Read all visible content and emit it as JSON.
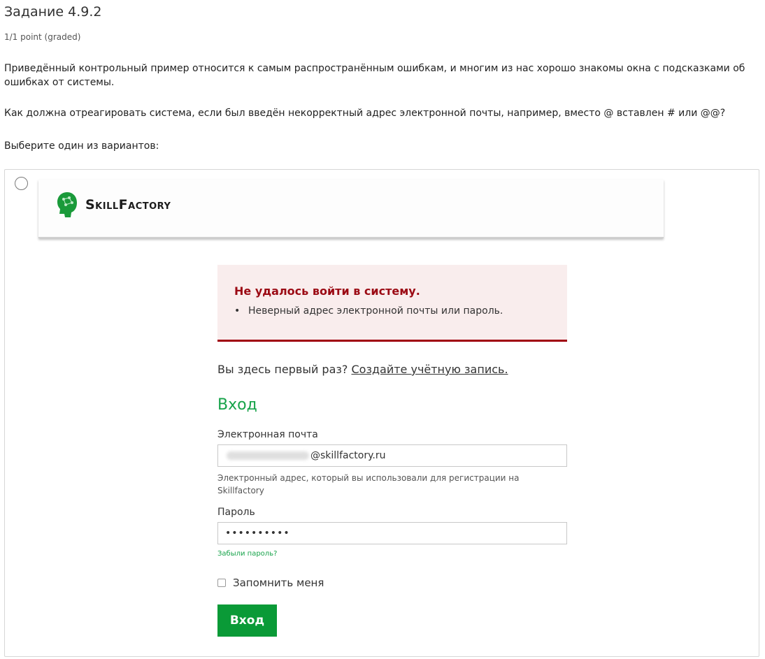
{
  "task": {
    "title": "Задание 4.9.2",
    "points": "1/1 point (graded)",
    "paragraph1": "Приведённый контрольный пример относится к самым распространённым ошибкам, и многим из нас хорошо знакомы окна с подсказками об ошибках от системы.",
    "paragraph2": "Как должна отреагировать система, если был введён некорректный адрес электронной почты, например, вместо @ вставлен # или @@?",
    "paragraph3": "Выберите один из вариантов:"
  },
  "option": {
    "logo_text": "SkillFactory",
    "error": {
      "title": "Не удалось войти в систему.",
      "bullet": "•",
      "item": "Неверный адрес электронной почты или пароль."
    },
    "first_time": {
      "text": "Вы здесь первый раз?",
      "link": "Создайте учётную запись."
    },
    "login_heading": "Вход",
    "email": {
      "label": "Электронная почта",
      "value_domain": "@skillfactory.ru",
      "hint": "Электронный адрес, который вы использовали для регистрации на Skillfactory"
    },
    "password": {
      "label": "Пароль",
      "value": "••••••••••",
      "forgot": "Забыли пароль?"
    },
    "remember_label": "Запомнить меня",
    "submit_label": "Вход"
  },
  "colors": {
    "brand_green": "#0a9a37",
    "heading_green": "#17a34a",
    "error_red": "#9b0a14",
    "error_bg": "#f9eded"
  }
}
